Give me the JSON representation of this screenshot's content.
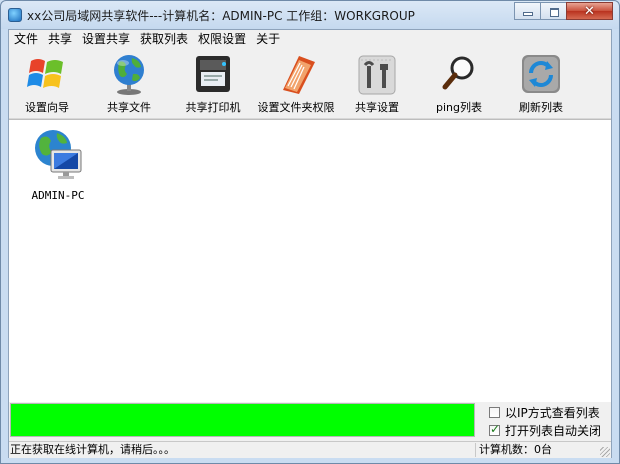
{
  "window": {
    "title": "xx公司局域网共享软件---计算机名：ADMIN-PC  工作组：WORKGROUP"
  },
  "caption": {
    "close": "✕"
  },
  "menu": [
    "文件",
    "共享",
    "设置共享",
    "获取列表",
    "权限设置",
    "关于"
  ],
  "toolbar": [
    {
      "label": "设置向导",
      "icon": "windows-logo-icon"
    },
    {
      "label": "共享文件",
      "icon": "globe-icon"
    },
    {
      "label": "共享打印机",
      "icon": "printer-icon"
    },
    {
      "label": "设置文件夹权限",
      "icon": "folder-book-icon"
    },
    {
      "label": "共享设置",
      "icon": "tools-icon"
    },
    {
      "label": "ping列表",
      "icon": "magnifier-icon"
    },
    {
      "label": "刷新列表",
      "icon": "refresh-icon"
    }
  ],
  "computers": [
    {
      "name": "ADMIN-PC",
      "icon": "network-computer-icon"
    }
  ],
  "progress": {
    "fraction": 1.0,
    "color": "#00ff00"
  },
  "options": {
    "ip_view": "以IP方式查看列表",
    "ip_view_checked": false,
    "auto_close": "打开列表自动关闭",
    "auto_close_checked": true
  },
  "status": {
    "message": "正在获取在线计算机，请稍后。。。",
    "count": "计算机数：0台"
  }
}
